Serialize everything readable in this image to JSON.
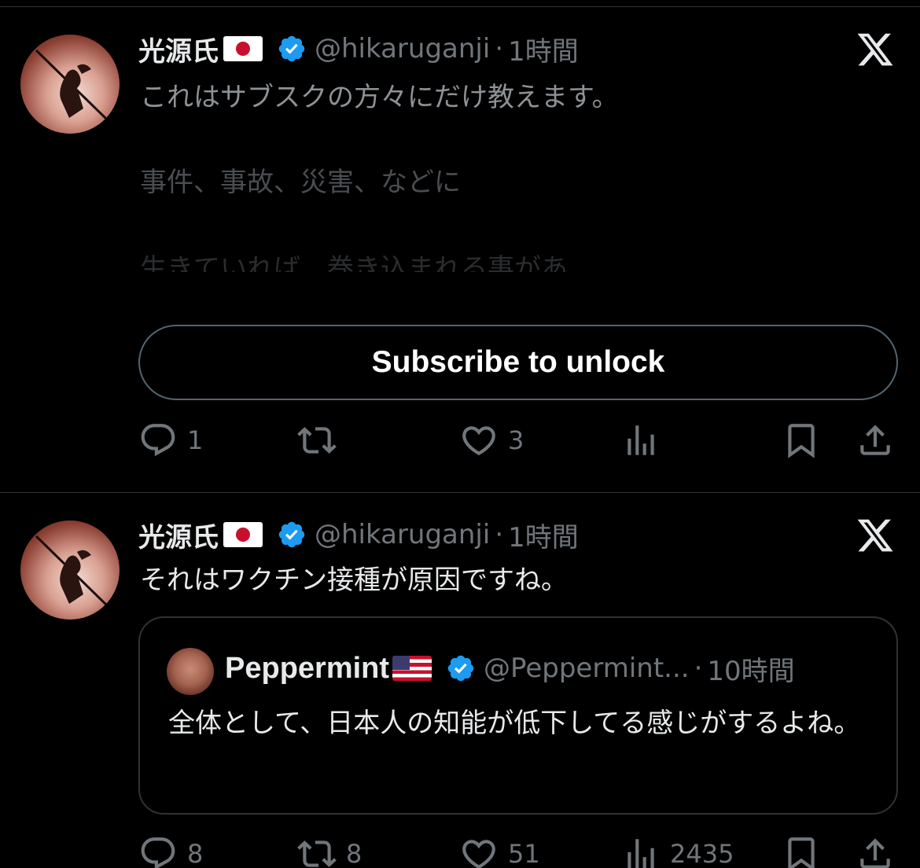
{
  "tweets": [
    {
      "display_name": "光源氏",
      "handle": "@hikaruganji",
      "time": "1時間",
      "text_lines": [
        "これはサブスクの方々にだけ教えます。",
        "事件、事故、災害、などに",
        "生きていれば、巻き込まれる事があ"
      ],
      "subscribe_label": "Subscribe to unlock",
      "replies": "1",
      "retweets": "",
      "likes": "3",
      "views": ""
    },
    {
      "display_name": "光源氏",
      "handle": "@hikaruganji",
      "time": "1時間",
      "text": "それはワクチン接種が原因ですね。",
      "quote": {
        "display_name": "Peppermint",
        "handle": "@Peppermint...",
        "time": "10時間",
        "text": "全体として、日本人の知能が低下してる感じがするよね。"
      },
      "replies": "8",
      "retweets": "8",
      "likes": "51",
      "views": "2435"
    }
  ],
  "separator": "·",
  "icons": {
    "reply": "reply-icon",
    "retweet": "retweet-icon",
    "like": "heart-icon",
    "views": "views-icon",
    "bookmark": "bookmark-icon",
    "share": "share-icon",
    "verified": "verified-badge-icon",
    "x_logo": "x-logo-icon"
  },
  "colors": {
    "background": "#000000",
    "text": "#e7e9ea",
    "muted": "#71767b",
    "verified": "#1d9bf0",
    "border": "#2f3336"
  }
}
